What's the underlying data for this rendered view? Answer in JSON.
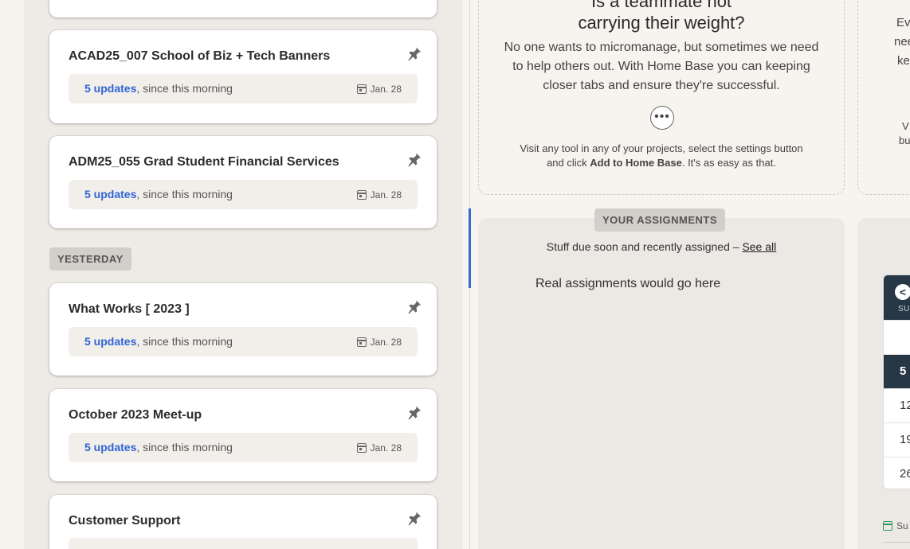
{
  "pinned": {
    "top_cards": [
      {
        "title": "ACAD25_007 School of Biz + Tech Banners",
        "update_count": "5 updates",
        "update_rest": ", since this morning",
        "date": "Jan. 28"
      },
      {
        "title": "ADM25_055 Grad Student Financial Services",
        "update_count": "5 updates",
        "update_rest": ", since this morning",
        "date": "Jan. 28"
      }
    ],
    "section_label": "YESTERDAY",
    "bottom_cards": [
      {
        "title": "What Works [ 2023 ]",
        "update_count": "5 updates",
        "update_rest": ", since this morning",
        "date": "Jan. 28"
      },
      {
        "title": "October 2023 Meet-up",
        "update_count": "5 updates",
        "update_rest": ", since this morning",
        "date": "Jan. 28"
      },
      {
        "title": "Customer Support"
      }
    ]
  },
  "tip": {
    "heading_line1": "Is a teammate not",
    "heading_line2": "carrying their weight?",
    "body": "No one wants to micromanage, but sometimes we need to help others out. With Home Base you can keeping closer tabs and ensure they're successful.",
    "more_label": "•••",
    "footer_pre": "Visit any tool in any of your projects, select the settings button and click ",
    "footer_bold": "Add to Home Base",
    "footer_post": ". It's as easy as that."
  },
  "tip2": {
    "peek1": "Ev",
    "peek2": "nee",
    "peek3": "ke",
    "peek4": "V",
    "peek5": "bu"
  },
  "assignments": {
    "label": "YOUR ASSIGNMENTS",
    "subtitle": "Stuff due soon and recently assigned – ",
    "see_all": "See all",
    "placeholder": "Real assignments would go here"
  },
  "schedule": {
    "prev_label": "<",
    "day_label": "SU",
    "weeks": [
      "",
      "5",
      "12",
      "19",
      "26"
    ],
    "active_week": "5",
    "footer": "Su",
    "accent": "#283746"
  },
  "colors": {
    "link": "#2f64d4",
    "scroll_indicator": "#3568d4"
  }
}
